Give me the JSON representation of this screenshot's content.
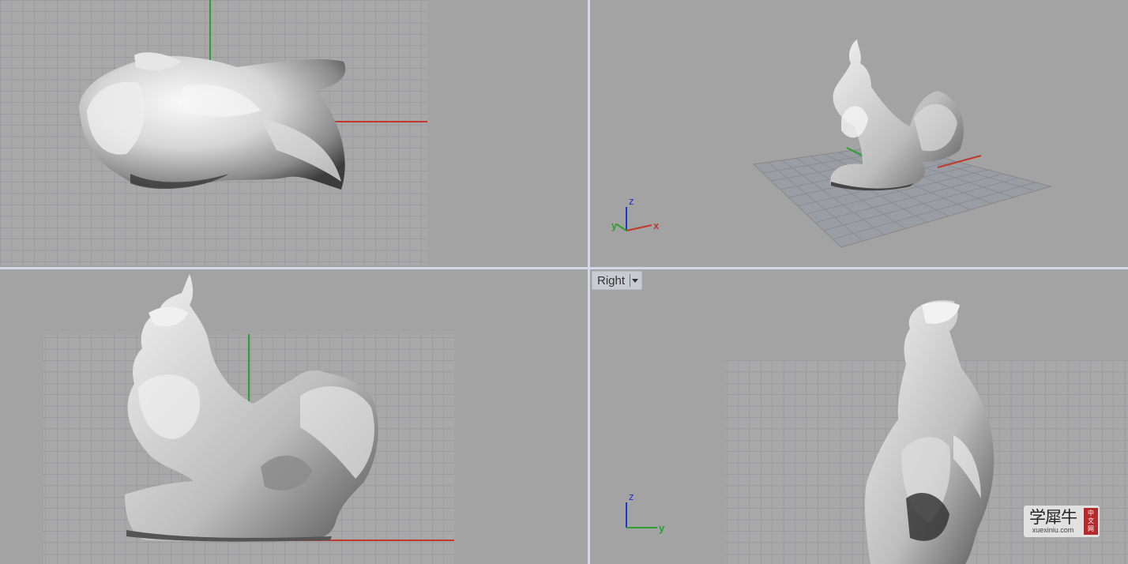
{
  "viewports": {
    "top": {
      "label": ""
    },
    "perspective": {
      "axis_labels": {
        "z": "z",
        "y": "y",
        "x": "x"
      }
    },
    "front": {
      "label": ""
    },
    "right": {
      "label": "Right",
      "axis_labels": {
        "z": "z",
        "y": "y"
      }
    }
  },
  "watermark": {
    "main": "学犀牛",
    "sub": "xuexiniu.com",
    "seal": [
      "中",
      "文",
      "网"
    ]
  },
  "colors": {
    "viewport_bg": "#a3a3a3",
    "grid_line": "#8f9298",
    "x_axis": "#c0392b",
    "y_axis": "#2e9e2e",
    "z_axis": "#2233cc",
    "splitter": "#d4d7e6"
  }
}
